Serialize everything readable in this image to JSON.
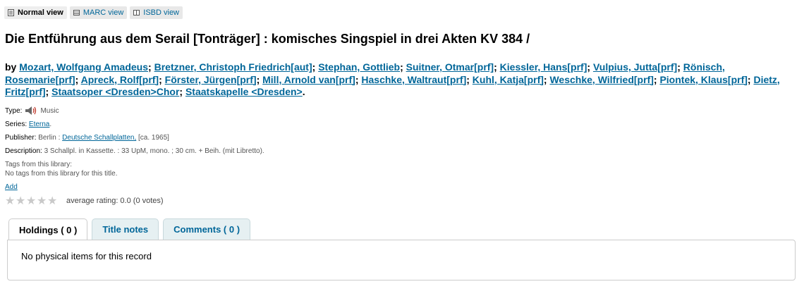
{
  "views": [
    {
      "label": "Normal view",
      "icon": "document-icon"
    },
    {
      "label": "MARC view",
      "icon": "table-icon"
    },
    {
      "label": "ISBD view",
      "icon": "book-icon"
    }
  ],
  "title": "Die Entführung aus dem Serail [Tonträger] : komisches Singspiel in drei Akten KV 384 /",
  "authors": {
    "by": "by",
    "names": [
      "Mozart, Wolfgang Amadeus",
      "Bretzner, Christoph Friedrich[aut]",
      "Stephan, Gottlieb",
      "Suitner, Otmar[prf]",
      "Kiessler, Hans[prf]",
      "Vulpius, Jutta[prf]",
      "Rönisch, Rosemarie[prf]",
      "Apreck, Rolf[prf]",
      "Förster, Jürgen[prf]",
      "Mill, Arnold van[prf]",
      "Haschke, Waltraut[prf]",
      "Kuhl, Katja[prf]",
      "Weschke, Wilfried[prf]",
      "Piontek, Klaus[prf]",
      "Dietz, Fritz[prf]",
      "Staatsoper <Dresden>Chor",
      "Staatskapelle <Dresden>"
    ]
  },
  "type": {
    "label": "Type:",
    "value": "Music",
    "icon": "speaker-icon"
  },
  "series": {
    "label": "Series:",
    "value": "Eterna",
    "suffix": "."
  },
  "publisher": {
    "label": "Publisher:",
    "place": "Berlin : ",
    "name": "Deutsche Schallplatten,",
    "date": " [ca. 1965]"
  },
  "description": {
    "label": "Description:",
    "value": "3 Schallpl. in Kassette. : 33 UpM, mono. ; 30 cm. + Beih. (mit Libretto)."
  },
  "tags": {
    "label": "Tags from this library:",
    "value": "No tags from this library for this title.",
    "add": "Add"
  },
  "rating": {
    "stars": 5,
    "filled": 0,
    "text": "average rating: 0.0 (0 votes)"
  },
  "tabs": [
    {
      "label": "Holdings ( 0 )",
      "active": true
    },
    {
      "label": "Title notes",
      "active": false
    },
    {
      "label": "Comments ( 0 )",
      "active": false
    }
  ],
  "holdings_text": "No physical items for this record"
}
